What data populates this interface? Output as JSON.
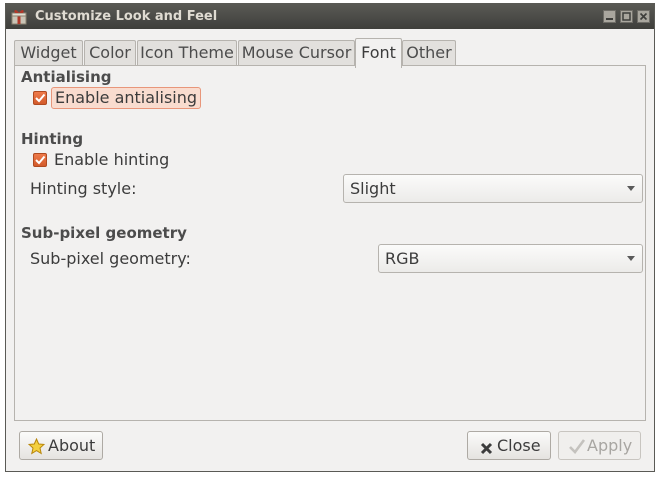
{
  "window": {
    "title": "Customize Look and Feel",
    "app_icon": "gift-box-icon"
  },
  "tabs": [
    {
      "label": "Widget",
      "active": false
    },
    {
      "label": "Color",
      "active": false
    },
    {
      "label": "Icon Theme",
      "active": false
    },
    {
      "label": "Mouse Cursor",
      "active": false
    },
    {
      "label": "Font",
      "active": true
    },
    {
      "label": "Other",
      "active": false
    }
  ],
  "antialiasing": {
    "title": "Antialising",
    "enable_label": "Enable antialising",
    "enabled": true
  },
  "hinting": {
    "title": "Hinting",
    "enable_label": "Enable hinting",
    "enabled": true,
    "style_label": "Hinting style:",
    "style_value": "Slight"
  },
  "subpixel": {
    "title": "Sub-pixel geometry",
    "label": "Sub-pixel geometry:",
    "value": "RGB"
  },
  "buttons": {
    "about": "About",
    "close": "Close",
    "apply": "Apply"
  },
  "colors": {
    "accent": "#dd6633",
    "titlebar": "#3e3e3b",
    "background": "#f2f1f0"
  }
}
